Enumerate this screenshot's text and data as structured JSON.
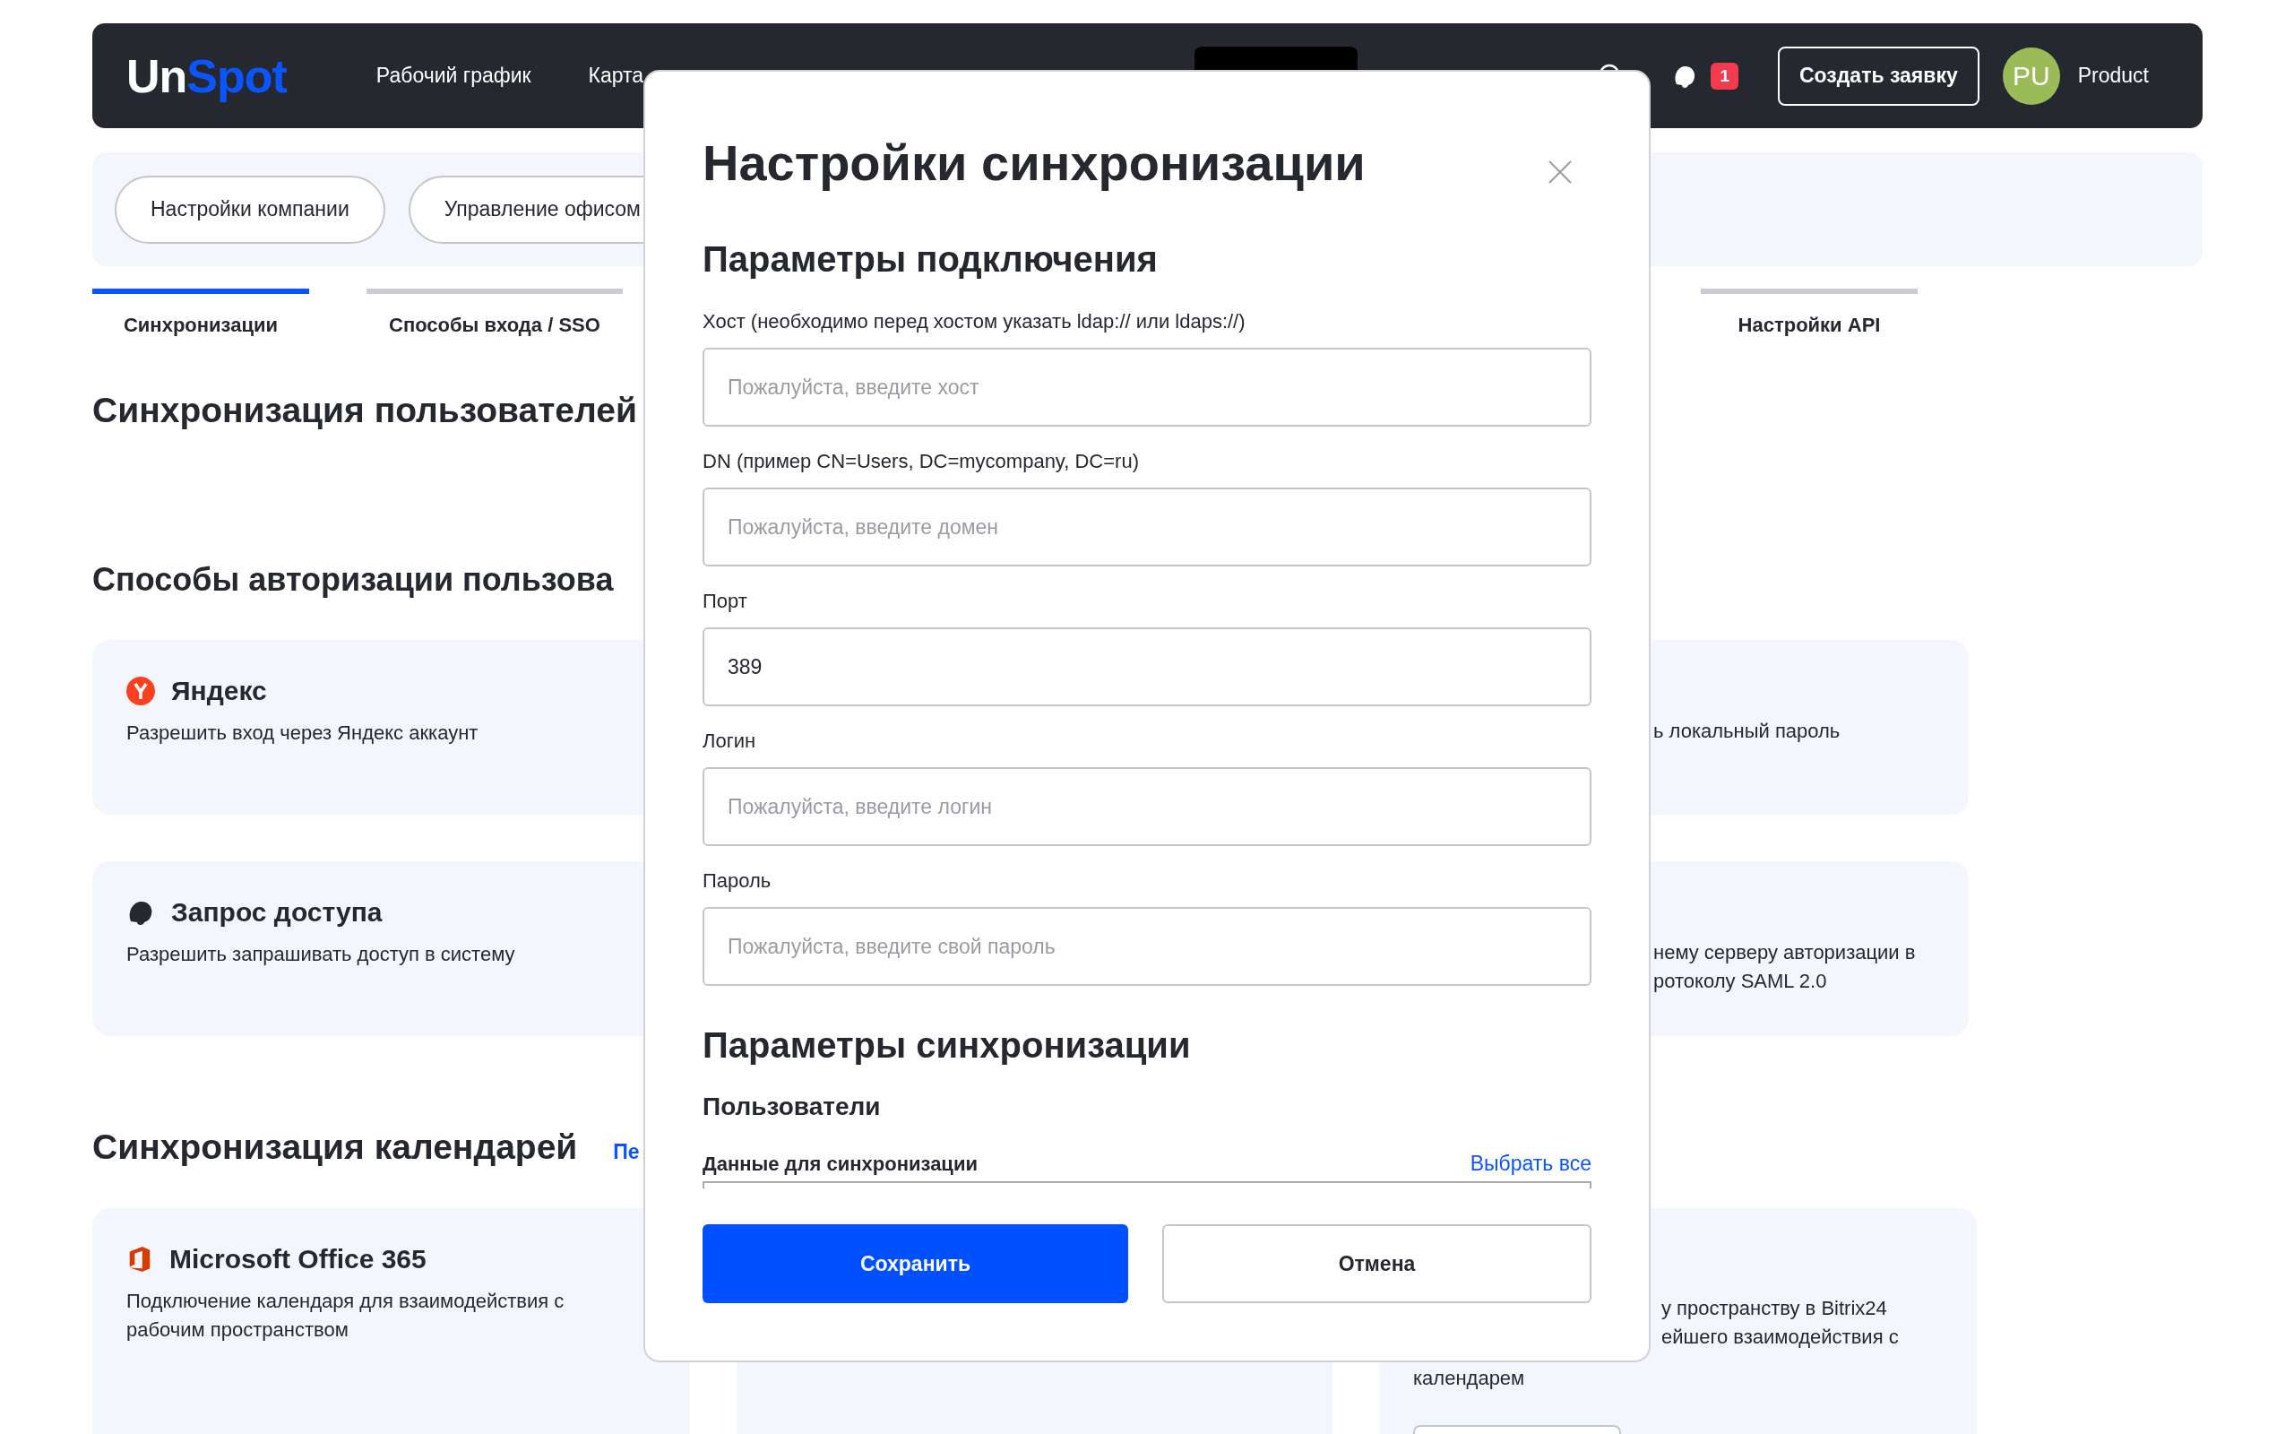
{
  "header": {
    "logo": {
      "first": "Un",
      "second": "Spot"
    },
    "nav": [
      {
        "label": "Рабочий график"
      },
      {
        "label": "Карта"
      }
    ],
    "notification_count": "1",
    "create_button": "Создать заявку",
    "user": {
      "initials": "PU",
      "name": "Product"
    }
  },
  "subnav": [
    {
      "label": "Настройки компании"
    },
    {
      "label": "Управление офисом"
    }
  ],
  "tabs": [
    {
      "label": "Синхронизации",
      "selected": true
    },
    {
      "label": "Способы входа / SSO",
      "selected": false
    },
    {
      "label": "Настройки API",
      "selected": false
    }
  ],
  "user_sync": {
    "heading": "Синхронизация пользователей"
  },
  "auth": {
    "heading": "Способы авторизации пользова",
    "cards": [
      {
        "kind": "yandex",
        "title": "Яндекс",
        "description": "Разрешить вход через Яндекс аккаунт"
      },
      {
        "kind": "request",
        "title": "Запрос доступа",
        "description": "Разрешить запрашивать доступ в систему"
      }
    ],
    "right_cards": [
      {
        "lines": [
          "ь локальный пароль"
        ]
      },
      {
        "lines": [
          "нему серверу авторизации в",
          "ротоколу SAML 2.0"
        ]
      }
    ]
  },
  "calendars": {
    "heading": "Синхронизация календарей",
    "link": "Пе",
    "card": {
      "kind": "office",
      "title": "Microsoft Office 365",
      "description": "Подключение календаря для взаимодействия с рабочим пространством"
    },
    "right_card": {
      "cut_lines": [
        "у пространству в Bitrix24",
        "ейшего взаимодействия с"
      ],
      "line": "календарем"
    }
  },
  "modal": {
    "title": "Настройки синхронизации",
    "connection_heading": "Параметры подключения",
    "fields": [
      {
        "label": "Хост (необходимо перед хостом указать ldap:// или ldaps://)",
        "placeholder": "Пожалуйста, введите хост"
      },
      {
        "label": "DN (пример CN=Users, DC=mycompany, DC=ru)",
        "placeholder": "Пожалуйста, введите домен"
      },
      {
        "label": "Порт",
        "value": "389"
      },
      {
        "label": "Логин",
        "placeholder": "Пожалуйста, введите логин"
      },
      {
        "label": "Пароль",
        "placeholder": "Пожалуйста, введите свой пароль"
      }
    ],
    "sync_heading": "Параметры синхронизации",
    "users_heading": "Пользователи",
    "data_label": "Данные для синхронизации",
    "select_all": "Выбрать все",
    "save": "Сохранить",
    "cancel": "Отмена"
  }
}
